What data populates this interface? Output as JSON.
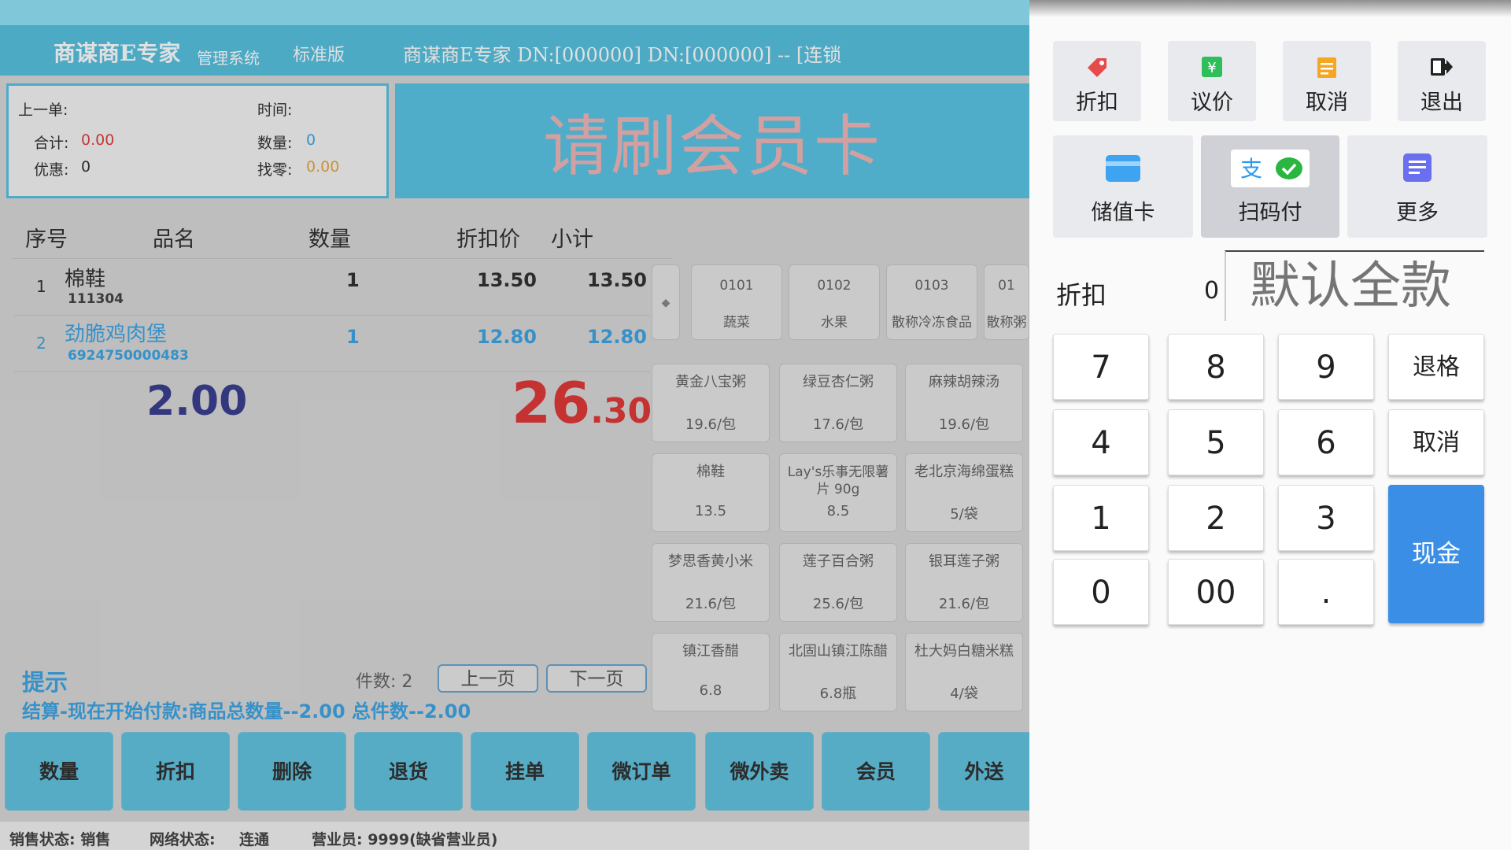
{
  "title_bar": {
    "app_name": "商谋商E专家",
    "subtitle": "管理系统",
    "edition": "标准版",
    "info": "商谋商E专家 DN:[000000] DN:[000000] -- [连锁"
  },
  "info_box": {
    "prev_order_label": "上一单:",
    "time_label": "时间:",
    "total_label": "合计:",
    "total_value": "0.00",
    "qty_label": "数量:",
    "qty_value": "0",
    "discount_label": "优惠:",
    "discount_value": "0",
    "change_label": "找零:",
    "change_value": "0.00"
  },
  "banner": "请刷会员卡",
  "columns": {
    "index": "序号",
    "name": "品名",
    "qty": "数量",
    "price": "折扣价",
    "subtotal": "小计"
  },
  "rows": [
    {
      "index": "1",
      "name": "棉鞋",
      "code": "111304",
      "qty": "1",
      "price": "13.50",
      "subtotal": "13.50"
    },
    {
      "index": "2",
      "name": "劲脆鸡肉堡",
      "code": "6924750000483",
      "qty": "1",
      "price": "12.80",
      "subtotal": "12.80"
    }
  ],
  "summary": {
    "qty": "2.00",
    "total_int": "26",
    "total_dec": ".30"
  },
  "hint": {
    "label": "提示",
    "text": "结算-现在开始付款:商品总数量--2.00 总件数--2.00",
    "count_label": "件数: 2",
    "prev_page": "上一页",
    "next_page": "下一页"
  },
  "categories": [
    {
      "code": "0101",
      "name": "蔬菜"
    },
    {
      "code": "0102",
      "name": "水果"
    },
    {
      "code": "0103",
      "name": "散称冷冻食品"
    },
    {
      "code": "01",
      "name": "散称粥"
    }
  ],
  "products": [
    {
      "name": "黄金八宝粥",
      "price": "19.6/包"
    },
    {
      "name": "绿豆杏仁粥",
      "price": "17.6/包"
    },
    {
      "name": "麻辣胡辣汤",
      "price": "19.6/包"
    },
    {
      "name": "棉鞋",
      "price": "13.5"
    },
    {
      "name": "Lay's乐事无限薯片 90g",
      "price": "8.5"
    },
    {
      "name": "老北京海绵蛋糕",
      "price": "5/袋"
    },
    {
      "name": "梦思香黄小米",
      "price": "21.6/包"
    },
    {
      "name": "莲子百合粥",
      "price": "25.6/包"
    },
    {
      "name": "银耳莲子粥",
      "price": "21.6/包"
    },
    {
      "name": "镇江香醋",
      "price": "6.8"
    },
    {
      "name": "北固山镇江陈醋",
      "price": "6.8瓶"
    },
    {
      "name": "杜大妈白糖米糕",
      "price": "4/袋"
    }
  ],
  "function_buttons": [
    "数量",
    "折扣",
    "删除",
    "退货",
    "挂单",
    "微订单",
    "微外卖",
    "会员",
    "外送"
  ],
  "status_bar": {
    "sale_status": "销售状态: 销售",
    "network_status_label": "网络状态:",
    "network_status": "连通",
    "clerk": "营业员: 9999(缺省营业员)"
  },
  "payment": {
    "discount_btn": "折扣",
    "negotiate_btn": "议价",
    "cancel_btn": "取消",
    "exit_btn": "退出",
    "stored_card_btn": "储值卡",
    "scan_pay_btn": "扫码付",
    "more_btn": "更多",
    "discount_label": "折扣",
    "discount_value": "0",
    "amount_placeholder": "默认全款",
    "keys": {
      "k7": "7",
      "k8": "8",
      "k9": "9",
      "backspace": "退格",
      "k4": "4",
      "k5": "5",
      "k6": "6",
      "cancel": "取消",
      "k1": "1",
      "k2": "2",
      "k3": "3",
      "k0": "0",
      "k00": "00",
      "dot": ".",
      "cash": "现金"
    },
    "colors": {
      "cash": "#3b8ee6",
      "tag": "#e84a4a",
      "money": "#2fbf5a",
      "note": "#f5a623",
      "card": "#3ea3f0",
      "more": "#6a6ff0",
      "wechat": "#2ab640",
      "alipay": "#2f9ae8"
    }
  }
}
